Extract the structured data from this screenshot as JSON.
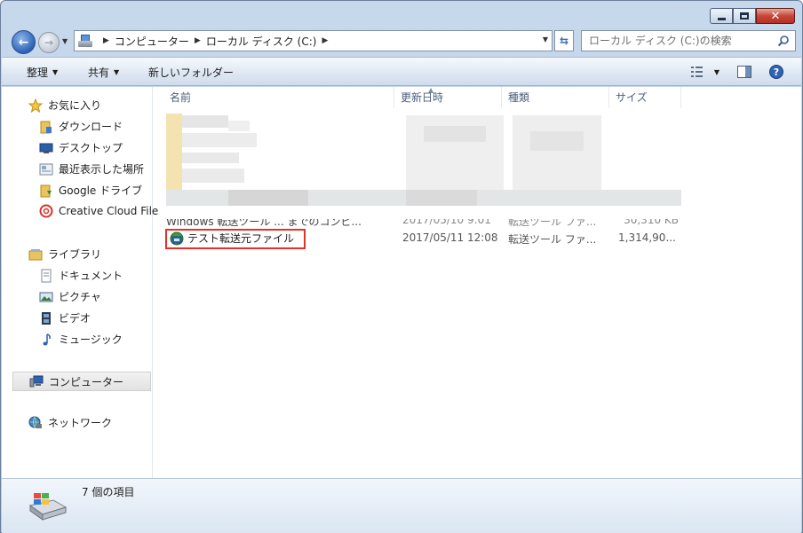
{
  "window": {
    "caption": {
      "minimize": "—",
      "maximize": "□",
      "close": "✕"
    }
  },
  "address": {
    "crumbs": [
      "コンピューター",
      "ローカル ディスク (C:)"
    ],
    "search_placeholder": "ローカル ディスク (C:)の検索"
  },
  "toolbar": {
    "organize": "整理",
    "share": "共有",
    "new_folder": "新しいフォルダー"
  },
  "nav": {
    "favorites": "お気に入り",
    "favorites_items": [
      "ダウンロード",
      "デスクトップ",
      "最近表示した場所",
      "Google ドライブ",
      "Creative Cloud File"
    ],
    "libraries": "ライブラリ",
    "libraries_items": [
      "ドキュメント",
      "ピクチャ",
      "ビデオ",
      "ミュージック"
    ],
    "computer": "コンピューター",
    "network": "ネットワーク"
  },
  "columns": {
    "name": "名前",
    "modified": "更新日時",
    "type": "種類",
    "size": "サイズ"
  },
  "files": [
    {
      "name": "Windows 転送ツール ... までのコンピ...",
      "modified": "2017/05/10 9:01",
      "type": "転送ツール ファ...",
      "size": "30,310 KB"
    },
    {
      "name": "テスト転送元ファイル",
      "modified": "2017/05/11 12:08",
      "type": "転送ツール ファ...",
      "size": "1,314,90..."
    }
  ],
  "status": {
    "item_count": "7 個の項目"
  },
  "colors": {
    "highlight": "#e0312a",
    "window_frame": "#b8cde6"
  }
}
